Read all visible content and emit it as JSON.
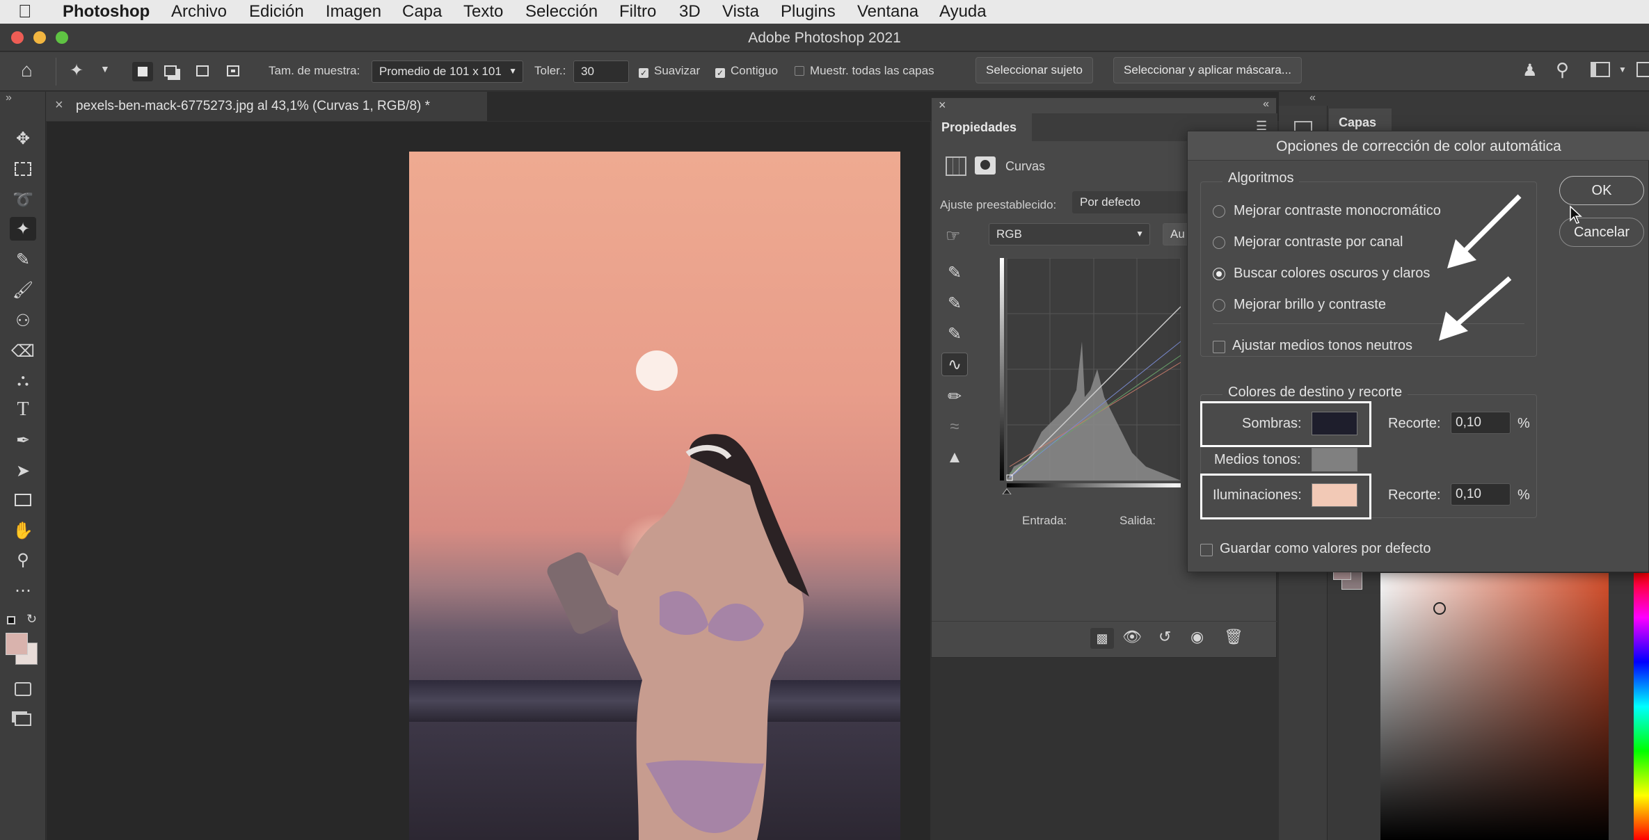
{
  "menubar": {
    "apple_icon": "apple-logo",
    "app_name": "Photoshop",
    "items": [
      "Archivo",
      "Edición",
      "Imagen",
      "Capa",
      "Texto",
      "Selección",
      "Filtro",
      "3D",
      "Vista",
      "Plugins",
      "Ventana",
      "Ayuda"
    ]
  },
  "window": {
    "title": "Adobe Photoshop 2021"
  },
  "options_bar": {
    "sample_size_label": "Tam. de muestra:",
    "sample_size_value": "Promedio de 101 x 101",
    "tolerance_label": "Toler.:",
    "tolerance_value": "30",
    "antialias_label": "Suavizar",
    "contiguous_label": "Contiguo",
    "sample_all_label": "Muestr. todas las capas",
    "select_subject": "Seleccionar sujeto",
    "select_mask": "Seleccionar y aplicar máscara..."
  },
  "document": {
    "tab_title": "pexels-ben-mack-6775273.jpg al 43,1% (Curvas 1, RGB/8) *"
  },
  "properties_panel": {
    "tab": "Propiedades",
    "adjustment_name": "Curvas",
    "preset_label": "Ajuste preestablecido:",
    "preset_value": "Por defecto",
    "channel_value": "RGB",
    "auto_label": "Au",
    "input_label": "Entrada:",
    "output_label": "Salida:"
  },
  "layers_panel": {
    "tab": "Capas"
  },
  "dialog": {
    "title": "Opciones de corrección de color automática",
    "algorithms_label": "Algoritmos",
    "options": [
      {
        "label": "Mejorar contraste monocromático",
        "selected": false
      },
      {
        "label": "Mejorar contraste por canal",
        "selected": false
      },
      {
        "label": "Buscar colores oscuros y claros",
        "selected": true
      },
      {
        "label": "Mejorar brillo y contraste",
        "selected": false
      }
    ],
    "snap_neutral_label": "Ajustar medios tonos neutros",
    "snap_neutral_checked": false,
    "target_label": "Colores de destino y recorte",
    "shadows_label": "Sombras:",
    "shadows_color": "#1e1e2c",
    "midtones_label": "Medios tonos:",
    "midtones_color": "#808080",
    "highlights_label": "Iluminaciones:",
    "highlights_color": "#f2c9b6",
    "clip_label": "Recorte:",
    "shadows_clip": "0,10",
    "highlights_clip": "0,10",
    "percent": "%",
    "save_defaults_label": "Guardar como valores por defecto",
    "ok": "OK",
    "cancel": "Cancelar"
  },
  "colors": {
    "foreground": "#d9b3ad",
    "background": "#e8dcd8"
  }
}
